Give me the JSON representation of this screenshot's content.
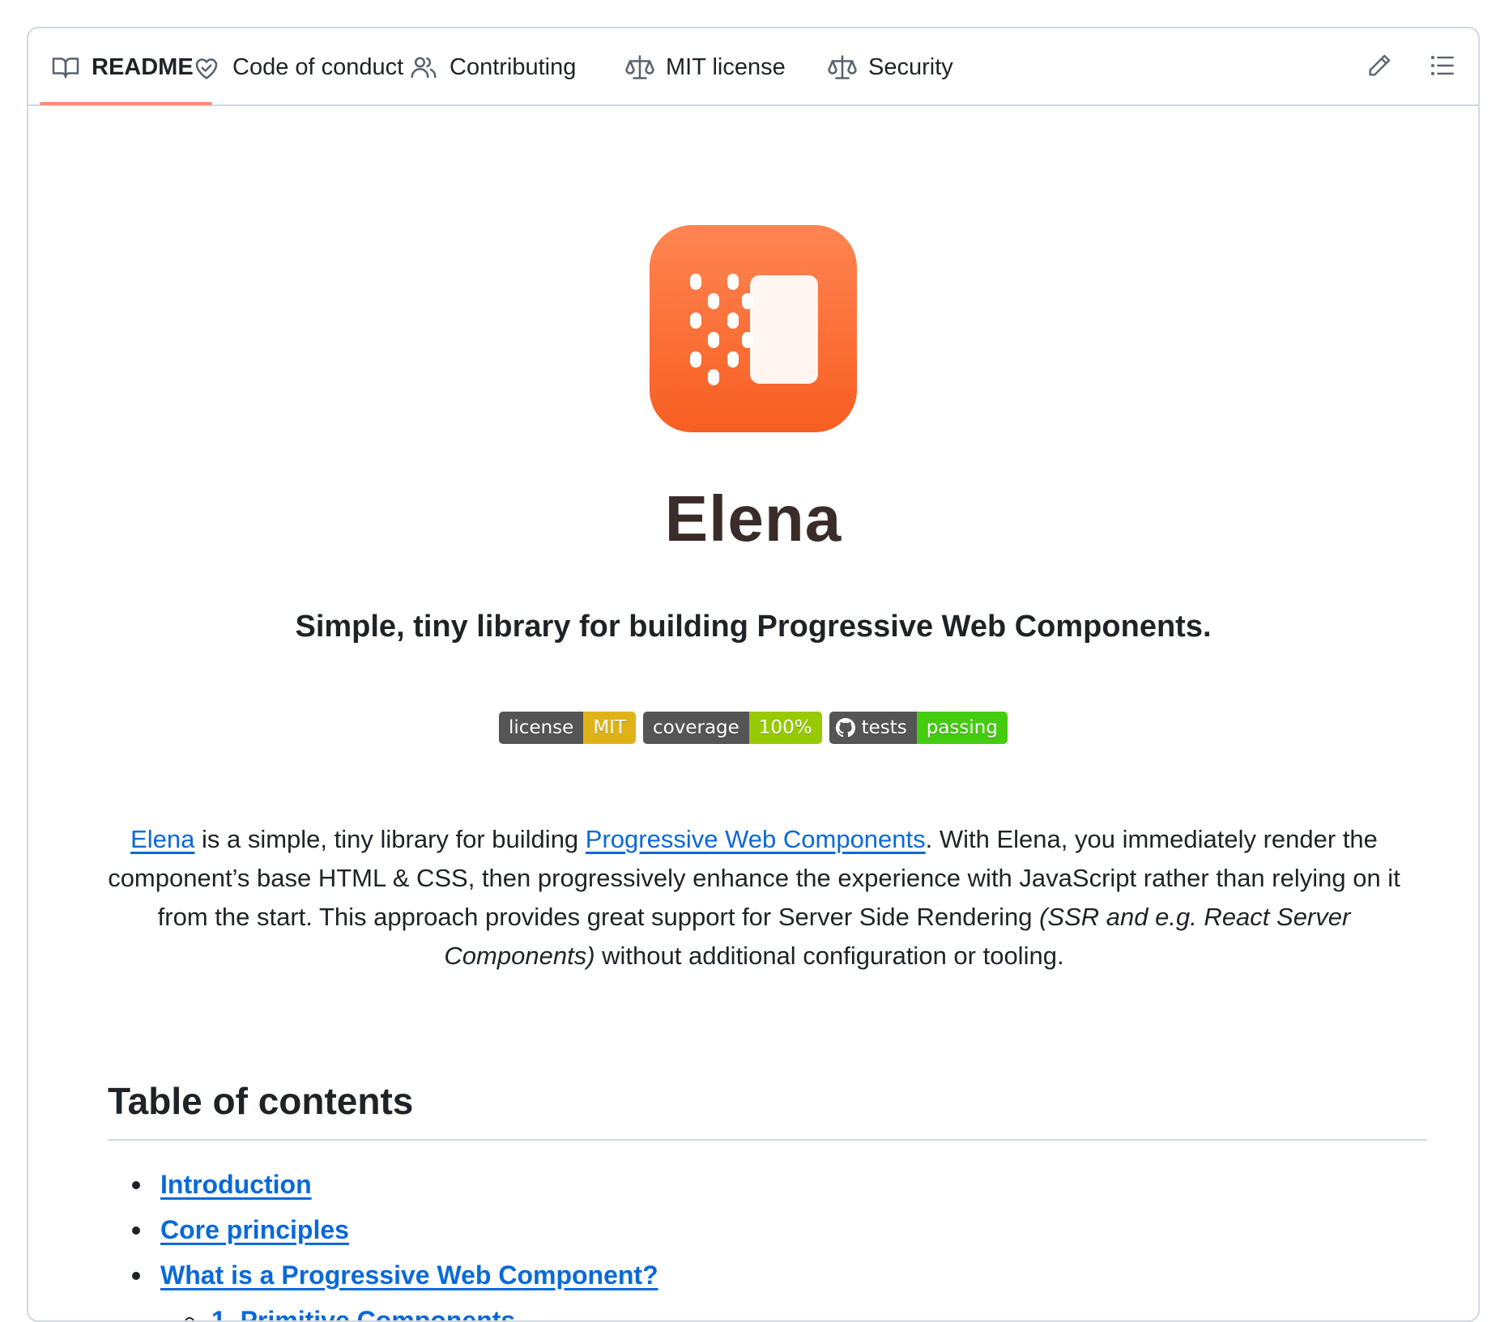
{
  "tabs": [
    {
      "label": "README",
      "icon": "book-icon",
      "active": true
    },
    {
      "label": "Code of conduct",
      "icon": "heart-hands-icon"
    },
    {
      "label": "Contributing",
      "icon": "people-icon"
    },
    {
      "label": "MIT license",
      "icon": "scale-icon"
    },
    {
      "label": "Security",
      "icon": "scale-icon"
    }
  ],
  "toolbar": {
    "edit_icon": "pencil-icon",
    "outline_icon": "list-icon"
  },
  "colors": {
    "accent": "#fd8c73",
    "link": "#0969da",
    "logo_top": "#ff8552",
    "logo_bottom": "#f75e21"
  },
  "readme": {
    "title": "Elena",
    "tagline": "Simple, tiny library for building Progressive Web Components.",
    "badges": [
      {
        "key": "license",
        "value": "MIT",
        "color": "#dfb317"
      },
      {
        "key": "coverage",
        "value": "100%",
        "color": "#97ca00"
      },
      {
        "key": "tests",
        "value": "passing",
        "color": "#44cc11",
        "icon": "github-icon"
      }
    ],
    "intro": {
      "link1": "Elena",
      "text1": " is a simple, tiny library for building ",
      "link2": "Progressive Web Components",
      "text2": ". With Elena, you immediately render the component’s base HTML & CSS, then progressively enhance the experience with JavaScript rather than relying on it from the start. This approach provides great support for Server Side Rendering ",
      "italic": "(SSR and e.g. React Server Components)",
      "text3": " without additional configuration or tooling."
    },
    "toc_title": "Table of contents",
    "toc": [
      {
        "label": "Introduction",
        "level": 1
      },
      {
        "label": "Core principles",
        "level": 1
      },
      {
        "label": "What is a Progressive Web Component?",
        "level": 1
      },
      {
        "label": "1. Primitive Components",
        "level": 2
      }
    ]
  }
}
